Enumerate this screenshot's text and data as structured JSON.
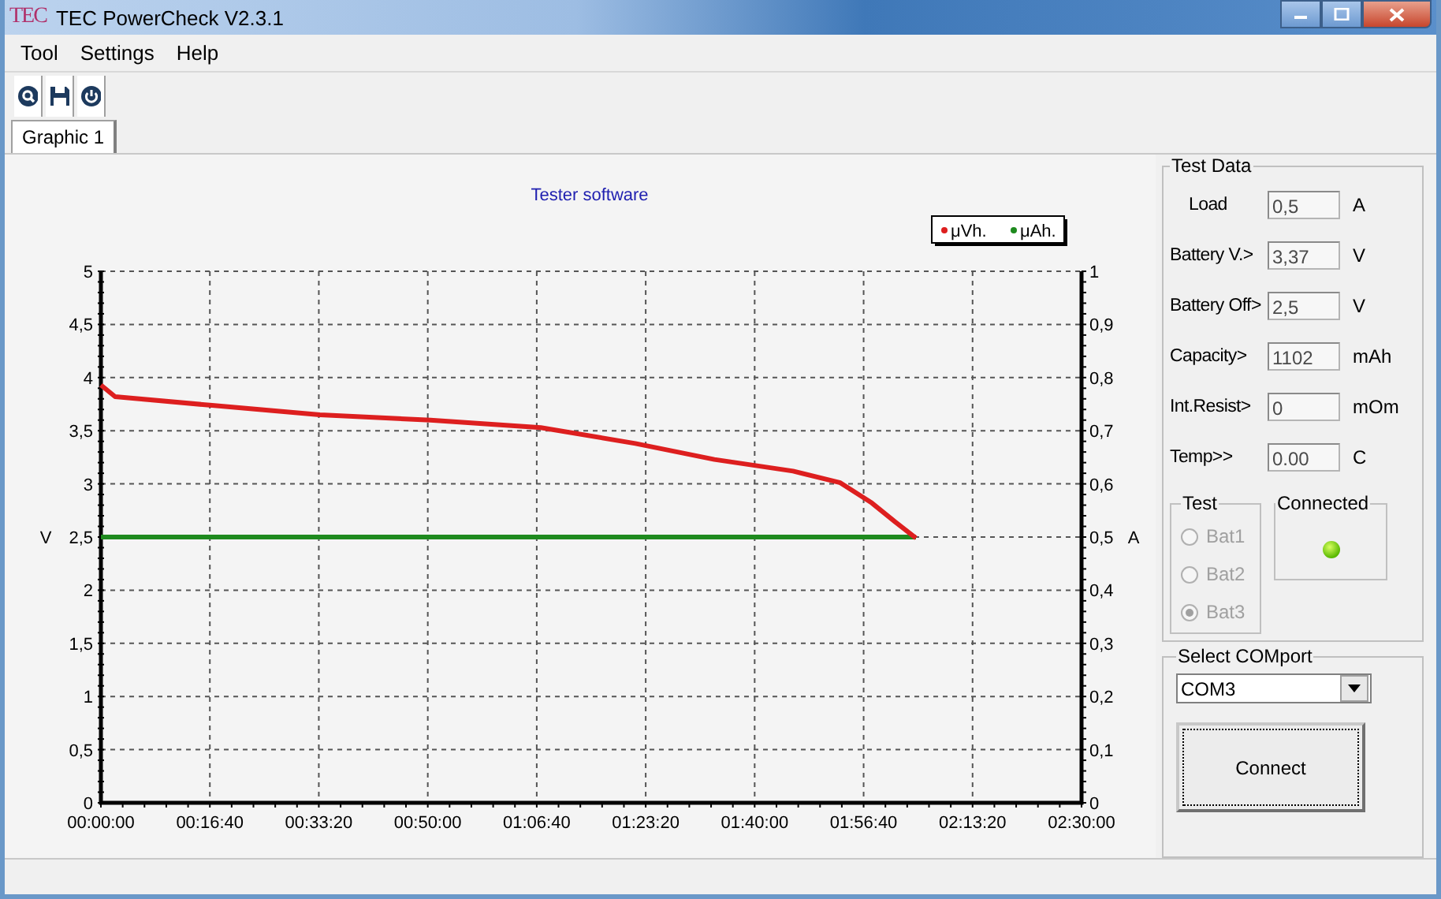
{
  "window": {
    "logo": "TEC",
    "title": "TEC PowerCheck V2.3.1"
  },
  "menu": [
    "Tool",
    "Settings",
    "Help"
  ],
  "tabs": [
    {
      "label": "Graphic 1",
      "selected": true
    }
  ],
  "chart": {
    "subtitle": "Tester software",
    "left_unit": "V",
    "right_unit": "A",
    "right_ticks": [
      "1",
      "0,9",
      "0,8",
      "0,7",
      "0,6",
      "0,5",
      "0,4",
      "0,3",
      "0,2",
      "0,1",
      "0"
    ],
    "chart_data": {
      "type": "line",
      "x": [
        0,
        130,
        1000,
        2010,
        3024,
        4037,
        4905,
        5630,
        6352,
        6786,
        7076,
        7293,
        7481
      ],
      "series": [
        {
          "name": "μVh.",
          "color": "#dd1f1f",
          "values": [
            3.93,
            3.82,
            3.74,
            3.65,
            3.6,
            3.53,
            3.38,
            3.23,
            3.12,
            3.01,
            2.82,
            2.64,
            2.49
          ]
        },
        {
          "name": "μAh.",
          "color": "#1e8a1e",
          "values": [
            2.5,
            2.5,
            2.5,
            2.5,
            2.5,
            2.5,
            2.5,
            2.5,
            2.5,
            2.5,
            2.5,
            2.5,
            2.5
          ]
        }
      ],
      "grid": true,
      "legend": true,
      "xlim": [
        0,
        9000
      ],
      "ylim": [
        0,
        5
      ],
      "xticks": [
        {
          "value": 0,
          "label": "00:00:00"
        },
        {
          "value": 1000,
          "label": "00:16:40"
        },
        {
          "value": 2000,
          "label": "00:33:20"
        },
        {
          "value": 3000,
          "label": "00:50:00"
        },
        {
          "value": 4000,
          "label": "01:06:40"
        },
        {
          "value": 5000,
          "label": "01:23:20"
        },
        {
          "value": 6000,
          "label": "01:40:00"
        },
        {
          "value": 7000,
          "label": "01:56:40"
        },
        {
          "value": 8000,
          "label": "02:13:20"
        },
        {
          "value": 9000,
          "label": "02:30:00"
        }
      ],
      "yticks": [
        {
          "value": 0,
          "label": "0"
        },
        {
          "value": 0.5,
          "label": "0,5"
        },
        {
          "value": 1,
          "label": "1"
        },
        {
          "value": 1.5,
          "label": "1,5"
        },
        {
          "value": 2,
          "label": "2"
        },
        {
          "value": 2.5,
          "label": "2,5"
        },
        {
          "value": 3,
          "label": "3"
        },
        {
          "value": 3.5,
          "label": "3,5"
        },
        {
          "value": 4,
          "label": "4"
        },
        {
          "value": 4.5,
          "label": "4,5"
        },
        {
          "value": 5,
          "label": "5"
        }
      ]
    }
  },
  "test_data": {
    "title": "Test Data",
    "fields": [
      {
        "label": "Load",
        "value": "0,5",
        "unit": "A"
      },
      {
        "label": "Battery V.>",
        "value": "3,37",
        "unit": "V"
      },
      {
        "label": "Battery Off>",
        "value": "2,5",
        "unit": "V"
      },
      {
        "label": "Capacity>",
        "value": "1102",
        "unit": "mAh"
      },
      {
        "label": "Int.Resist>",
        "value": "0",
        "unit": "mOm"
      },
      {
        "label": "Temp>>",
        "value": "0.00",
        "unit": "C"
      }
    ]
  },
  "test_group": {
    "title": "Test",
    "options": [
      {
        "label": "Bat1",
        "selected": false,
        "disabled": true
      },
      {
        "label": "Bat2",
        "selected": false,
        "disabled": true
      },
      {
        "label": "Bat3",
        "selected": true,
        "disabled": true
      }
    ]
  },
  "connection": {
    "title": "Connected",
    "on": true
  },
  "comport": {
    "title": "Select COMport",
    "value": "COM3",
    "button": "Connect"
  }
}
